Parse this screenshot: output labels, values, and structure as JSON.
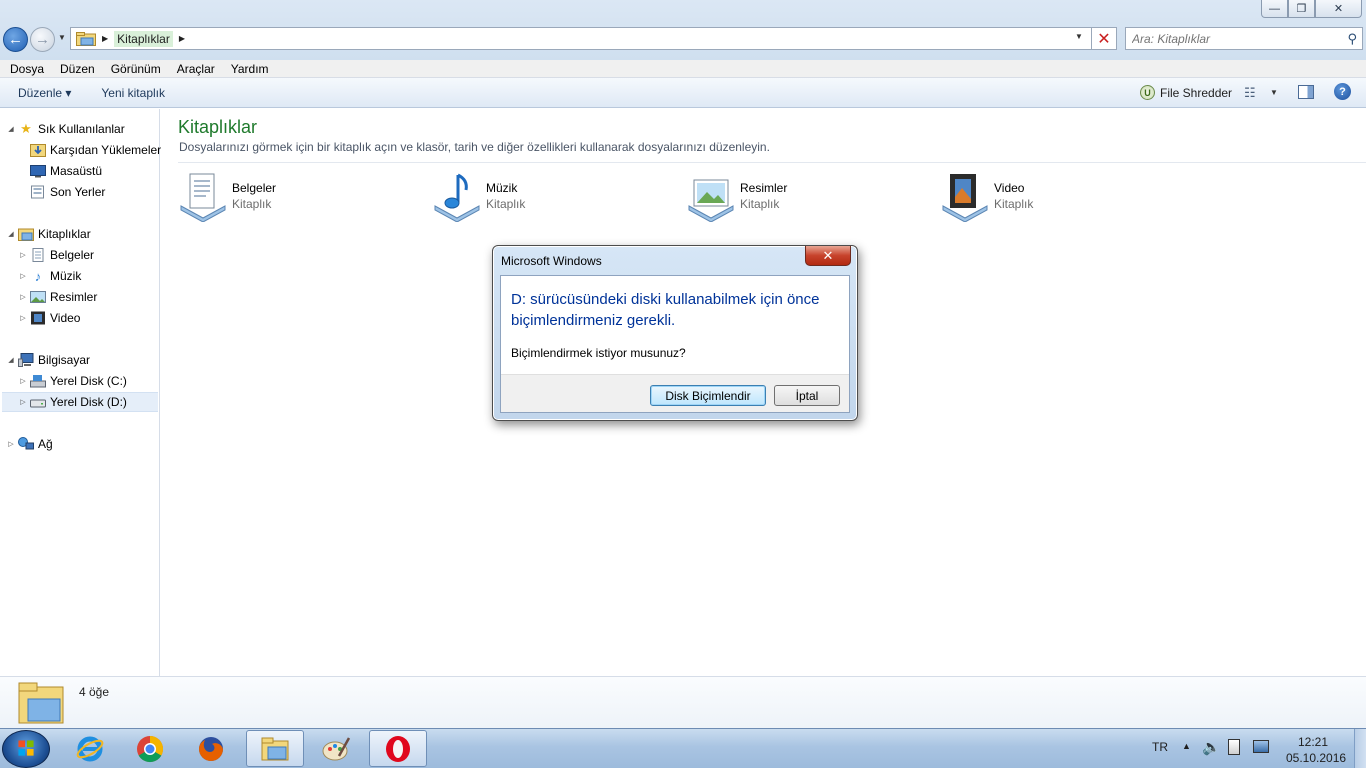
{
  "window": {
    "minimize": "—",
    "maximize": "❐",
    "close": "✕"
  },
  "address": {
    "breadcrumb": "Kitaplıklar",
    "stop": "✕"
  },
  "search": {
    "placeholder": "Ara: Kitaplıklar"
  },
  "menu": [
    "Dosya",
    "Düzen",
    "Görünüm",
    "Araçlar",
    "Yardım"
  ],
  "toolbar": {
    "organize_label": "Düzenle ▾",
    "new_library_label": "Yeni kitaplık",
    "shredder_label": "File Shredder",
    "shredder_icon_letter": "U",
    "help": "?"
  },
  "nav": {
    "favorites": {
      "header": "Sık Kullanılanlar",
      "items": [
        "Karşıdan Yüklemeler",
        "Masaüstü",
        "Son Yerler"
      ]
    },
    "libraries": {
      "header": "Kitaplıklar",
      "items": [
        "Belgeler",
        "Müzik",
        "Resimler",
        "Video"
      ]
    },
    "computer": {
      "header": "Bilgisayar",
      "items": [
        "Yerel Disk (C:)",
        "Yerel Disk (D:)"
      ]
    },
    "network": {
      "header": "Ağ"
    }
  },
  "content": {
    "title": "Kitaplıklar",
    "description": "Dosyalarınızı görmek için bir kitaplık açın ve klasör, tarih ve diğer özellikleri kullanarak dosyalarınızı düzenleyin.",
    "libraries": [
      {
        "name": "Belgeler",
        "type": "Kitaplık",
        "icon": "documents-library-icon"
      },
      {
        "name": "Müzik",
        "type": "Kitaplık",
        "icon": "music-library-icon"
      },
      {
        "name": "Resimler",
        "type": "Kitaplık",
        "icon": "pictures-library-icon"
      },
      {
        "name": "Video",
        "type": "Kitaplık",
        "icon": "video-library-icon"
      }
    ]
  },
  "status": {
    "count": "4 öğe"
  },
  "dialog": {
    "title": "Microsoft Windows",
    "message": "D: sürücüsündeki diski kullanabilmek için önce biçimlendirmeniz gerekli.",
    "question": "Biçimlendirmek istiyor musunuz?",
    "format_button": "Disk Biçimlendir",
    "cancel_button": "İptal",
    "close": "✕"
  },
  "taskbar": {
    "apps": [
      "internet-explorer-icon",
      "chrome-icon",
      "firefox-icon",
      "explorer-icon",
      "paint-icon",
      "opera-icon"
    ],
    "language": "TR",
    "time": "12:21",
    "date": "05.10.2016"
  },
  "colors": {
    "title_green": "#1f7a2c",
    "dialog_text_blue": "#003399",
    "taskbar": "#a9c4e2"
  }
}
